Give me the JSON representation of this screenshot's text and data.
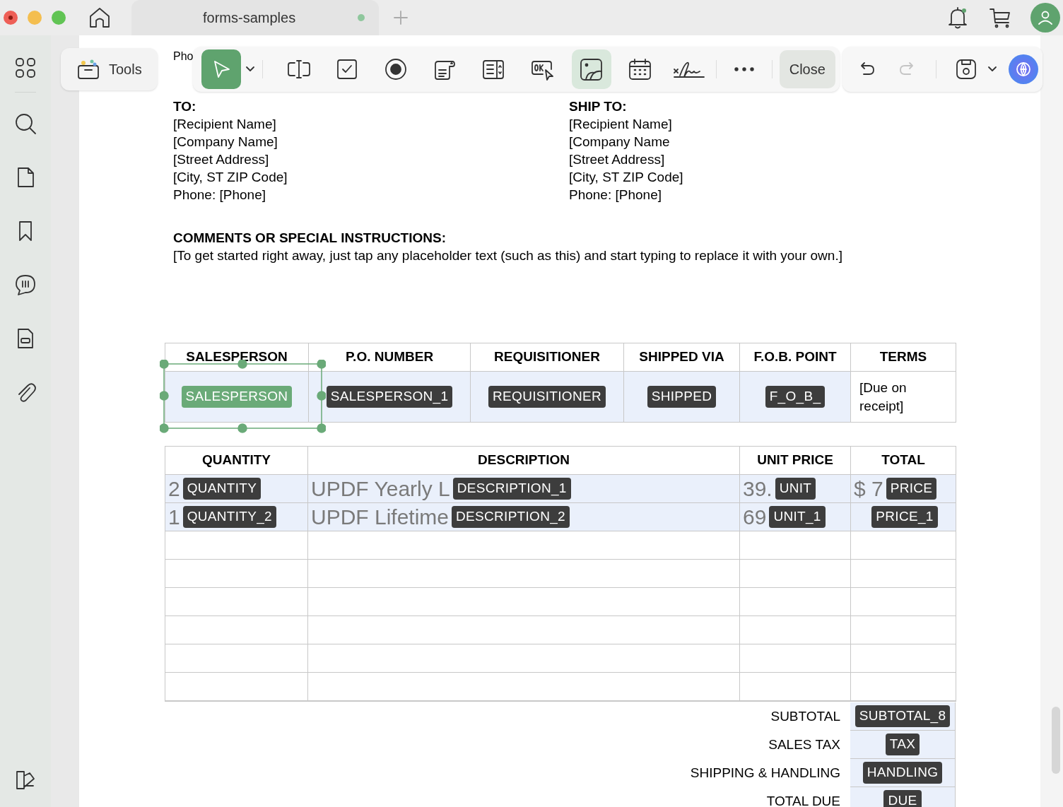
{
  "tab": {
    "title": "forms-samples",
    "unsaved": true
  },
  "tools_button": {
    "label": "Tools"
  },
  "toolbar": {
    "tools": [
      {
        "kind": "pointer",
        "selected": true
      },
      {
        "kind": "text-field",
        "selected": false
      },
      {
        "kind": "checkbox",
        "selected": false
      },
      {
        "kind": "radio",
        "selected": false
      },
      {
        "kind": "list-box",
        "selected": false
      },
      {
        "kind": "dropdown",
        "selected": false
      },
      {
        "kind": "push-button",
        "selected": false
      },
      {
        "kind": "image",
        "selected": true
      },
      {
        "kind": "date",
        "selected": false
      },
      {
        "kind": "signature",
        "selected": false
      }
    ],
    "close_label": "Close",
    "history": [
      {
        "kind": "undo",
        "disabled": false
      },
      {
        "kind": "redo",
        "disabled": true
      }
    ]
  },
  "document": {
    "partial_line": "Pho",
    "to": {
      "heading": "TO:",
      "lines": [
        "[Recipient Name]",
        "[Company Name]",
        "[Street Address]",
        "[City, ST ZIP Code]",
        "Phone: [Phone]"
      ]
    },
    "ship_to": {
      "heading": "SHIP TO:",
      "lines": [
        "[Recipient Name]",
        "[Company Name",
        "[Street Address]",
        "[City, ST ZIP Code]",
        "Phone: [Phone]"
      ]
    },
    "comments": {
      "heading": "COMMENTS OR SPECIAL INSTRUCTIONS:",
      "text": "[To get started right away, just tap any placeholder text (such as this) and start typing to replace it with your own.]"
    },
    "order_table": {
      "columns": [
        "SALESPERSON",
        "P.O. NUMBER",
        "REQUISITIONER",
        "SHIPPED VIA",
        "F.O.B. POINT",
        "TERMS"
      ],
      "cells": [
        {
          "kind": "field",
          "tag": "SALESPERSON",
          "selected": true
        },
        {
          "kind": "field",
          "tag": "SALESPERSON_1",
          "selected": false
        },
        {
          "kind": "field",
          "tag": "REQUISITIONER",
          "selected": false
        },
        {
          "kind": "field",
          "tag": "SHIPPED",
          "selected": false
        },
        {
          "kind": "field",
          "tag": "F_O_B_",
          "selected": false
        },
        {
          "kind": "text",
          "text": "[Due on receipt]"
        }
      ]
    },
    "items_table": {
      "columns": [
        "QUANTITY",
        "DESCRIPTION",
        "UNIT PRICE",
        "TOTAL"
      ],
      "rows": [
        [
          {
            "value": "2",
            "tag": "QUANTITY"
          },
          {
            "value": "UPDF Yearly L",
            "tag": "DESCRIPTION_1"
          },
          {
            "value": "39.",
            "tag": "UNIT"
          },
          {
            "value": "$ 7",
            "tag": "PRICE"
          }
        ],
        [
          {
            "value": "1",
            "tag": "QUANTITY_2"
          },
          {
            "value": "UPDF Lifetime",
            "tag": "DESCRIPTION_2"
          },
          {
            "value": "69",
            "tag": "UNIT_1"
          },
          {
            "tag": "PRICE_1"
          }
        ]
      ]
    },
    "totals": [
      {
        "label": "SUBTOTAL",
        "tag": "SUBTOTAL_8"
      },
      {
        "label": "SALES TAX",
        "tag": "TAX"
      },
      {
        "label": "SHIPPING & HANDLING",
        "tag": "HANDLING"
      },
      {
        "label": "TOTAL DUE",
        "tag": "DUE"
      }
    ]
  }
}
